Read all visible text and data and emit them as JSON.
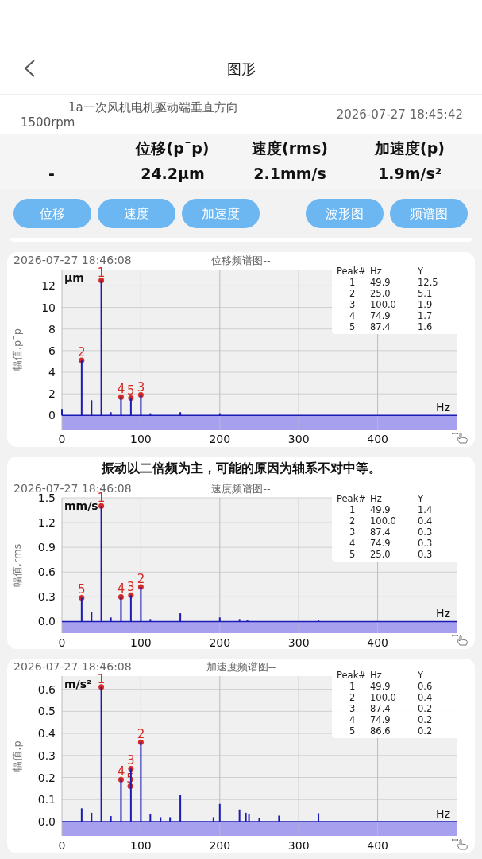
{
  "nav": {
    "title": "图形"
  },
  "info": {
    "point": "1a一次风机电机驱动端垂直方向",
    "speed": "1500rpm",
    "time": "2026-07-27 18:45:42"
  },
  "summary": {
    "columns": [
      "",
      "位移(p¯p)",
      "速度(rms)",
      "加速度(p)"
    ],
    "values": [
      "-",
      "24.2μm",
      "2.1mm/s",
      "1.9m/s²"
    ]
  },
  "buttons": [
    "位移",
    "速度",
    "加速度",
    "波形图",
    "频谱图"
  ],
  "charts": [
    {
      "timestamp": "2026-07-27 18:46:08",
      "title": "位移频谱图--",
      "unit": "μm",
      "peak_table": {
        "columns": [
          "Peak#",
          "Hz",
          "Y"
        ],
        "rows": [
          [
            "1",
            "49.9",
            "12.5"
          ],
          [
            "2",
            "25.0",
            "5.1"
          ],
          [
            "3",
            "100.0",
            "1.9"
          ],
          [
            "4",
            "74.9",
            "1.7"
          ],
          [
            "5",
            "87.4",
            "1.6"
          ]
        ]
      },
      "chart_data": {
        "type": "bar",
        "grid": true,
        "ref_lines": [
          {
            "axis": "y",
            "value": 0,
            "color": "#1c1cb4"
          }
        ],
        "bands": [
          {
            "axis": "y",
            "from": -1.3,
            "to": 0,
            "color": "#a7a0ef"
          }
        ],
        "xlabel": "Hz",
        "ylabel": "幅值,p¯p",
        "xlim": [
          0,
          500
        ],
        "ylim": [
          -1.3,
          13.5
        ],
        "xticks": [
          0,
          100,
          200,
          300,
          400
        ],
        "yticks": [
          0,
          2,
          4,
          6,
          8,
          10,
          12
        ],
        "x": [
          0,
          25,
          37.5,
          49.9,
          62,
          74.9,
          87.4,
          100,
          112,
          150,
          200
        ],
        "series": [
          {
            "color": "#1c1cb4",
            "values": [
              0.6,
              5.1,
              1.4,
              12.5,
              0.3,
              1.7,
              1.6,
              1.9,
              0.2,
              0.3,
              0.2
            ]
          }
        ],
        "annotations": [
          {
            "x": 49.9,
            "y": 12.5,
            "text": "1"
          },
          {
            "x": 25,
            "y": 5.1,
            "text": "2"
          },
          {
            "x": 100,
            "y": 1.9,
            "text": "3"
          },
          {
            "x": 74.9,
            "y": 1.7,
            "text": "4"
          },
          {
            "x": 87.4,
            "y": 1.6,
            "text": "5"
          }
        ]
      }
    },
    {
      "diagnosis": "振动以二倍频为主，可能的原因为轴系不对中等。",
      "timestamp": "2026-07-27 18:46:08",
      "title": "速度频谱图--",
      "unit": "mm/s",
      "peak_table": {
        "columns": [
          "Peak#",
          "Hz",
          "Y"
        ],
        "rows": [
          [
            "1",
            "49.9",
            "1.4"
          ],
          [
            "2",
            "100.0",
            "0.4"
          ],
          [
            "3",
            "87.4",
            "0.3"
          ],
          [
            "4",
            "74.9",
            "0.3"
          ],
          [
            "5",
            "25.0",
            "0.3"
          ]
        ]
      },
      "chart_data": {
        "type": "bar",
        "grid": true,
        "ref_lines": [
          {
            "axis": "y",
            "value": 0,
            "color": "#1c1cb4"
          }
        ],
        "bands": [
          {
            "axis": "y",
            "from": -0.14,
            "to": 0,
            "color": "#a7a0ef"
          }
        ],
        "xlabel": "Hz",
        "ylabel": "幅值,rms",
        "xlim": [
          0,
          500
        ],
        "ylim": [
          -0.14,
          1.5
        ],
        "xticks": [
          0,
          100,
          200,
          300,
          400
        ],
        "yticks": [
          {
            "value": 0,
            "label": "0.0"
          },
          {
            "value": 0.3,
            "label": "0.3"
          },
          {
            "value": 0.6,
            "label": "0.6"
          },
          {
            "value": 0.9,
            "label": "0.9"
          },
          {
            "value": 1.2,
            "label": "1.2"
          },
          {
            "value": 1.5,
            "label": "1.5"
          }
        ],
        "x": [
          25,
          37.5,
          49.9,
          62,
          74.9,
          87.4,
          100,
          112,
          150,
          200,
          225,
          235,
          325
        ],
        "series": [
          {
            "color": "#1c1cb4",
            "values": [
              0.29,
              0.12,
              1.4,
              0.05,
              0.3,
              0.32,
              0.42,
              0.03,
              0.1,
              0.05,
              0.03,
              0.02,
              0.02
            ]
          }
        ],
        "annotations": [
          {
            "x": 49.9,
            "y": 1.4,
            "text": "1"
          },
          {
            "x": 100,
            "y": 0.42,
            "text": "2"
          },
          {
            "x": 87.4,
            "y": 0.32,
            "text": "3"
          },
          {
            "x": 74.9,
            "y": 0.3,
            "text": "4"
          },
          {
            "x": 25,
            "y": 0.29,
            "text": "5"
          }
        ]
      }
    },
    {
      "timestamp": "2026-07-27 18:46:08",
      "title": "加速度频谱图--",
      "unit": "m/s²",
      "peak_table": {
        "columns": [
          "Peak#",
          "Hz",
          "Y"
        ],
        "rows": [
          [
            "1",
            "49.9",
            "0.6"
          ],
          [
            "2",
            "100.0",
            "0.4"
          ],
          [
            "3",
            "87.4",
            "0.2"
          ],
          [
            "4",
            "74.9",
            "0.2"
          ],
          [
            "5",
            "86.6",
            "0.2"
          ]
        ]
      },
      "chart_data": {
        "type": "bar",
        "grid": true,
        "ref_lines": [
          {
            "axis": "y",
            "value": 0,
            "color": "#1c1cb4"
          }
        ],
        "bands": [
          {
            "axis": "y",
            "from": -0.065,
            "to": 0,
            "color": "#a7a0ef"
          }
        ],
        "xlabel": "Hz",
        "ylabel": "幅值,p",
        "xlim": [
          0,
          500
        ],
        "ylim": [
          -0.065,
          0.66
        ],
        "xticks": [
          0,
          100,
          200,
          300,
          400
        ],
        "yticks": [
          {
            "value": 0,
            "label": "0.0"
          },
          {
            "value": 0.1,
            "label": "0.1"
          },
          {
            "value": 0.2,
            "label": "0.2"
          },
          {
            "value": 0.3,
            "label": "0.3"
          },
          {
            "value": 0.4,
            "label": "0.4"
          },
          {
            "value": 0.5,
            "label": "0.5"
          },
          {
            "value": 0.6,
            "label": "0.6"
          }
        ],
        "x": [
          25,
          37.5,
          49.9,
          62,
          74.9,
          86.6,
          87.4,
          100,
          112,
          125,
          137,
          150,
          192,
          200,
          225,
          233,
          237,
          250,
          275,
          325
        ],
        "series": [
          {
            "color": "#1c1cb4",
            "values": [
              0.06,
              0.04,
              0.61,
              0.025,
              0.19,
              null,
              0.24,
              0.36,
              0.033,
              0.02,
              0.02,
              0.12,
              0.02,
              0.08,
              0.055,
              0.04,
              0.035,
              0.015,
              0.027,
              0.038
            ]
          }
        ],
        "annotations": [
          {
            "x": 49.9,
            "y": 0.61,
            "text": "1"
          },
          {
            "x": 100,
            "y": 0.36,
            "text": "2"
          },
          {
            "x": 87.4,
            "y": 0.24,
            "text": "3"
          },
          {
            "x": 74.9,
            "y": 0.19,
            "text": "4"
          },
          {
            "x": 86.6,
            "y": 0.16,
            "text": "5"
          }
        ]
      }
    }
  ]
}
